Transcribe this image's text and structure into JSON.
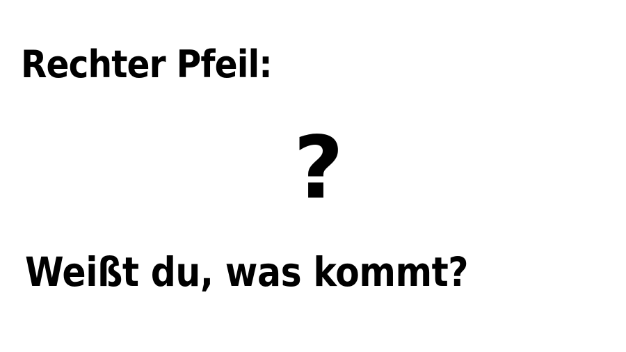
{
  "slide": {
    "heading": "Rechter Pfeil:",
    "symbol": "?",
    "prompt": "Weißt du, was kommt?"
  }
}
